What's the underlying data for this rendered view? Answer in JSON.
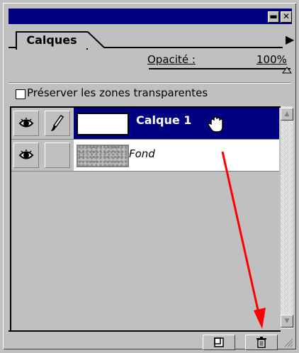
{
  "palette": {
    "tab_label": "Calques",
    "minimize_label": "▬",
    "close_label": "✕",
    "menu_arrow": "▶"
  },
  "opacity": {
    "label": "Opacité :",
    "value": "100%",
    "level": 1.0
  },
  "preserve_transparency": {
    "label": "Préserver les zones transparentes",
    "checked": false
  },
  "layers": [
    {
      "name": "Calque 1",
      "selected": true,
      "visible": true,
      "brush": true,
      "thumbnail": "white"
    },
    {
      "name": "Fond",
      "selected": false,
      "visible": true,
      "brush": false,
      "thumbnail": "texture"
    }
  ],
  "cursor": "hand-icon",
  "annotation": {
    "color": "#ff0000",
    "points_to": "delete-layer-button"
  },
  "colors": {
    "title_bar": "#000080",
    "selection": "#000080",
    "panel": "#c0c0c0",
    "arrow": "#ff0000"
  }
}
